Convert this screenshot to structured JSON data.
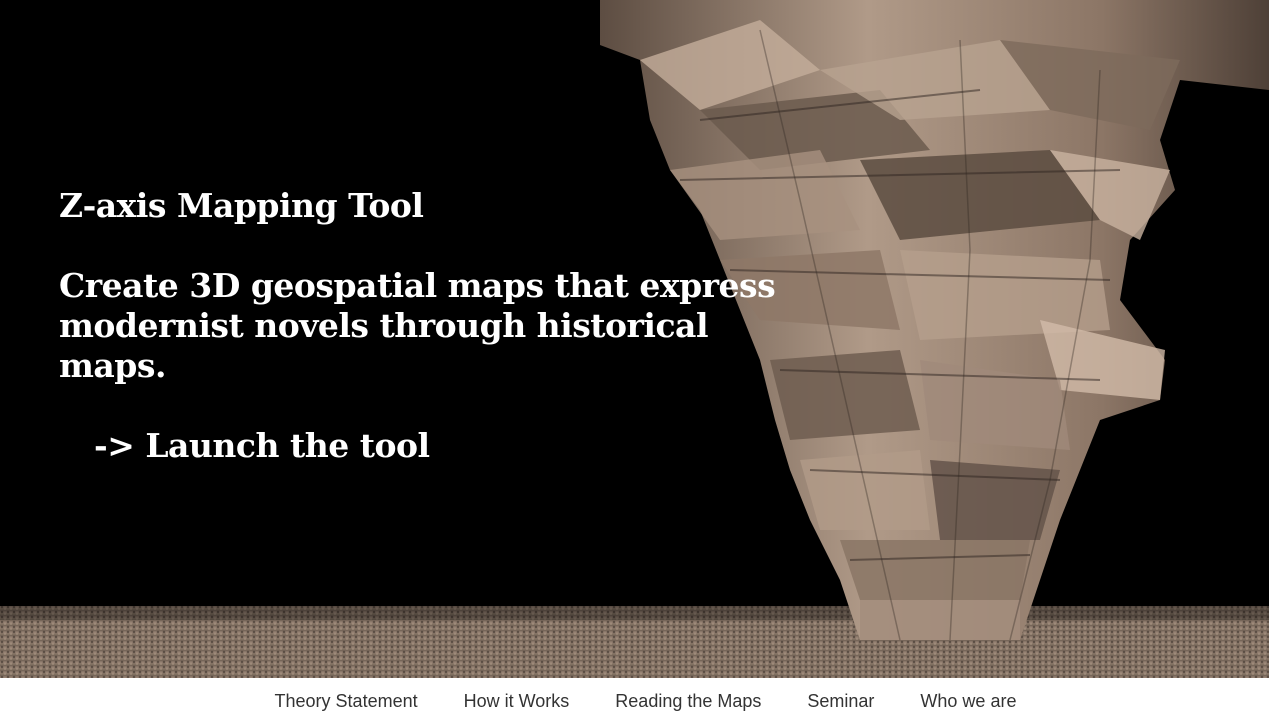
{
  "hero": {
    "title": "Z-axis Mapping Tool",
    "tagline": "Create 3D geospatial maps that express modernist novels through historical maps.",
    "launch_label": "-> Launch the tool"
  },
  "nav": {
    "items": [
      {
        "label": "Theory Statement"
      },
      {
        "label": "How it Works"
      },
      {
        "label": "Reading the Maps"
      },
      {
        "label": "Seminar"
      },
      {
        "label": "Who we are"
      }
    ]
  },
  "colors": {
    "background": "#000000",
    "text": "#ffffff",
    "sculpture": "#a08a78",
    "nav_background": "#ffffff",
    "nav_text": "#333333"
  }
}
